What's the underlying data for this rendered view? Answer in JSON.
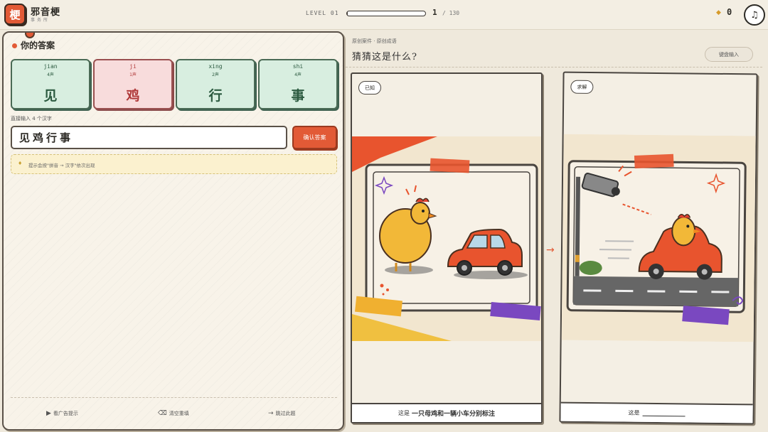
{
  "app": {
    "logo_char": "梗",
    "name": "邪音梗",
    "subtitle": "事务所"
  },
  "header": {
    "level_label": "LEVEL 01",
    "progress_fraction": 0.008,
    "current": "1",
    "total": "/ 130",
    "coins": "0",
    "coin_icon": "diamond-icon",
    "music_icon": "♫"
  },
  "answer": {
    "title": "你的答案",
    "tiles": [
      {
        "pinyin": "jian",
        "tone": "4声",
        "char": "见",
        "state": "correct"
      },
      {
        "pinyin": "ji",
        "tone": "1声",
        "char": "鸡",
        "state": "wrong"
      },
      {
        "pinyin": "xing",
        "tone": "2声",
        "char": "行",
        "state": "correct"
      },
      {
        "pinyin": "shi",
        "tone": "4声",
        "char": "事",
        "state": "correct"
      }
    ],
    "input_label": "直接输入 4 个汉字",
    "input_value": "见鸡行事",
    "confirm_label": "确认答案",
    "hint_text": "提示会按\"拼音 → 汉字\"依次出现"
  },
  "footer": {
    "ad_hint": "看广告提示",
    "clear": "清空重填",
    "skip": "跳过此题"
  },
  "puzzle": {
    "breadcrumb": "原创案件 · 原创成语",
    "question": "猜猜这是什么?",
    "keyboard_button": "键盘输入",
    "known_tag": "已知",
    "solve_tag": "求解",
    "known_caption_prefix": "这是",
    "known_caption": "一只母鸡和一辆小车分别标注",
    "solve_caption_prefix": "这是"
  },
  "colors": {
    "accent": "#e25a36",
    "correct": "#d8eee0",
    "wrong": "#f8dcdc"
  }
}
